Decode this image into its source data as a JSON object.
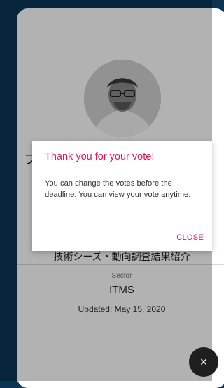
{
  "profile": {
    "name_partial": "フ",
    "title": "技術シーズ・動向調査結果紹介",
    "sector_label": "Sector",
    "sector_value": "ITMS",
    "updated": "Updated: May 15, 2020"
  },
  "dialog": {
    "title": "Thank you for your vote!",
    "body": "You can change the votes before the deadline. You can view your vote anytime.",
    "close_label": "CLOSE"
  },
  "fab": {
    "icon": "close-icon",
    "glyph": "×"
  },
  "colors": {
    "background": "#0b3553",
    "accent": "#e2165b",
    "fab": "#1f1f1f"
  }
}
